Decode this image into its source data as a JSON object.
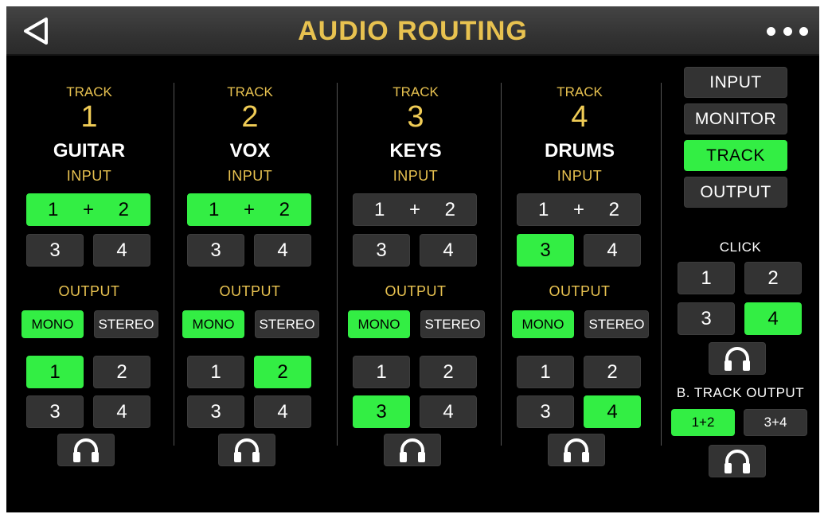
{
  "header": {
    "title": "AUDIO ROUTING"
  },
  "tracks": [
    {
      "track_label": "TRACK",
      "number": "1",
      "name": "GUITAR",
      "input_label": "INPUT",
      "output_label": "OUTPUT",
      "input_combo": {
        "a": "1",
        "plus": "+",
        "b": "2",
        "active": true
      },
      "inputs": [
        {
          "label": "3",
          "active": false
        },
        {
          "label": "4",
          "active": false
        }
      ],
      "modes": [
        {
          "label": "MONO",
          "active": true
        },
        {
          "label": "STEREO",
          "active": false
        }
      ],
      "outputs": [
        {
          "label": "1",
          "active": true
        },
        {
          "label": "2",
          "active": false
        },
        {
          "label": "3",
          "active": false
        },
        {
          "label": "4",
          "active": false
        }
      ]
    },
    {
      "track_label": "TRACK",
      "number": "2",
      "name": "VOX",
      "input_label": "INPUT",
      "output_label": "OUTPUT",
      "input_combo": {
        "a": "1",
        "plus": "+",
        "b": "2",
        "active": true
      },
      "inputs": [
        {
          "label": "3",
          "active": false
        },
        {
          "label": "4",
          "active": false
        }
      ],
      "modes": [
        {
          "label": "MONO",
          "active": true
        },
        {
          "label": "STEREO",
          "active": false
        }
      ],
      "outputs": [
        {
          "label": "1",
          "active": false
        },
        {
          "label": "2",
          "active": true
        },
        {
          "label": "3",
          "active": false
        },
        {
          "label": "4",
          "active": false
        }
      ]
    },
    {
      "track_label": "TRACK",
      "number": "3",
      "name": "KEYS",
      "input_label": "INPUT",
      "output_label": "OUTPUT",
      "input_combo": {
        "a": "1",
        "plus": "+",
        "b": "2",
        "active": false
      },
      "inputs": [
        {
          "label": "3",
          "active": false
        },
        {
          "label": "4",
          "active": false
        }
      ],
      "modes": [
        {
          "label": "MONO",
          "active": true
        },
        {
          "label": "STEREO",
          "active": false
        }
      ],
      "outputs": [
        {
          "label": "1",
          "active": false
        },
        {
          "label": "2",
          "active": false
        },
        {
          "label": "3",
          "active": true
        },
        {
          "label": "4",
          "active": false
        }
      ]
    },
    {
      "track_label": "TRACK",
      "number": "4",
      "name": "DRUMS",
      "input_label": "INPUT",
      "output_label": "OUTPUT",
      "input_combo": {
        "a": "1",
        "plus": "+",
        "b": "2",
        "active": false
      },
      "inputs": [
        {
          "label": "3",
          "active": true
        },
        {
          "label": "4",
          "active": false
        }
      ],
      "modes": [
        {
          "label": "MONO",
          "active": true
        },
        {
          "label": "STEREO",
          "active": false
        }
      ],
      "outputs": [
        {
          "label": "1",
          "active": false
        },
        {
          "label": "2",
          "active": false
        },
        {
          "label": "3",
          "active": false
        },
        {
          "label": "4",
          "active": true
        }
      ]
    }
  ],
  "sidebar": {
    "menu": [
      {
        "label": "INPUT",
        "active": false
      },
      {
        "label": "MONITOR",
        "active": false
      },
      {
        "label": "TRACK",
        "active": true
      },
      {
        "label": "OUTPUT",
        "active": false
      }
    ],
    "click_label": "CLICK",
    "click_outputs": [
      {
        "label": "1",
        "active": false
      },
      {
        "label": "2",
        "active": false
      },
      {
        "label": "3",
        "active": false
      },
      {
        "label": "4",
        "active": true
      }
    ],
    "btrack_label": "B. TRACK OUTPUT",
    "btrack_outputs": [
      {
        "label": "1+2",
        "active": true
      },
      {
        "label": "3+4",
        "active": false
      }
    ]
  },
  "colors": {
    "accent_yellow": "#e8c250",
    "active_green": "#33ee44",
    "button_gray": "#333333",
    "background": "#000000"
  },
  "icons": {
    "back": "back-triangle-icon",
    "more": "more-dots-icon",
    "headphones": "headphones-icon"
  }
}
